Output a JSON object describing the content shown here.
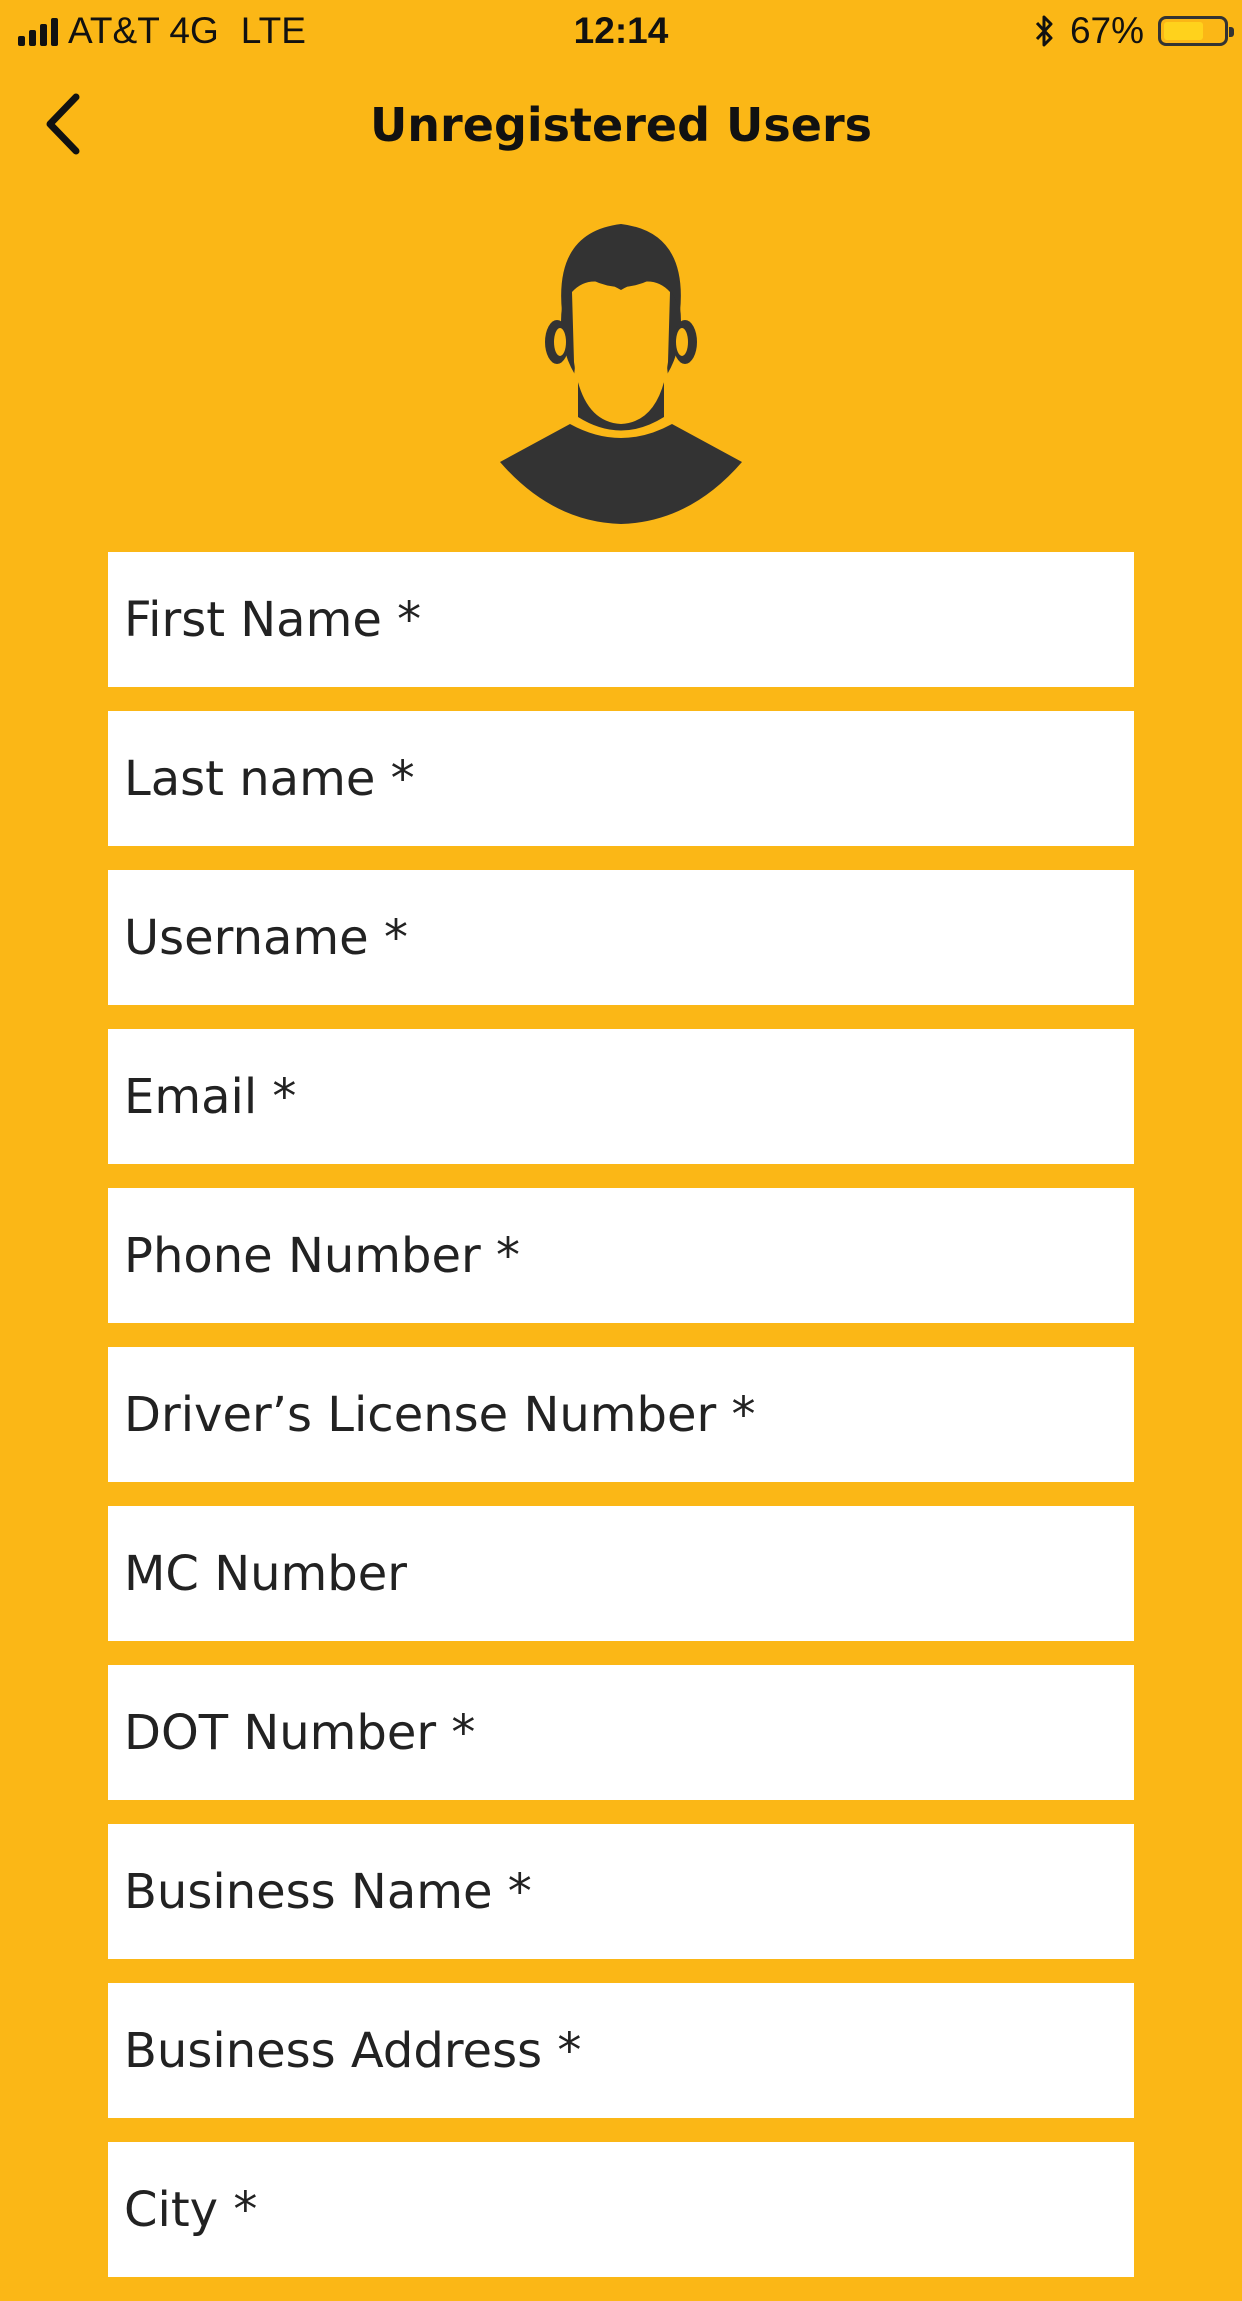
{
  "status_bar": {
    "carrier": "AT&T 4G",
    "network": "LTE",
    "time": "12:14",
    "battery_percent": "67%",
    "battery_level": 0.67,
    "icons": [
      "signal-icon",
      "bluetooth-icon",
      "battery-icon"
    ]
  },
  "nav": {
    "title": "Unregistered Users",
    "back_icon": "chevron-left-icon"
  },
  "avatar": {
    "icon": "user-avatar-icon"
  },
  "form": {
    "fields": [
      {
        "placeholder": "First Name *"
      },
      {
        "placeholder": "Last name *"
      },
      {
        "placeholder": "Username *"
      },
      {
        "placeholder": "Email *"
      },
      {
        "placeholder": "Phone Number *"
      },
      {
        "placeholder": "Driver’s License Number *"
      },
      {
        "placeholder": "MC Number"
      },
      {
        "placeholder": "DOT Number *"
      },
      {
        "placeholder": "Business Name *"
      },
      {
        "placeholder": "Business Address *"
      },
      {
        "placeholder": "City *"
      }
    ]
  },
  "colors": {
    "background": "#FBB716",
    "field_background": "#FFFFFF",
    "text": "#222222",
    "avatar": "#333333"
  }
}
